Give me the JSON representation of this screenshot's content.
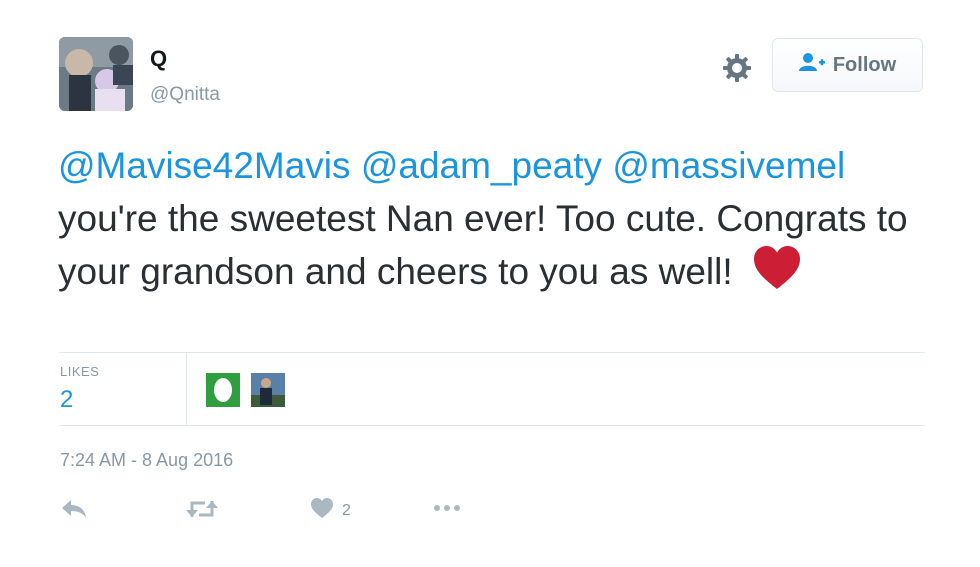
{
  "user": {
    "display_name": "Q",
    "handle": "@Qnitta"
  },
  "follow_button": {
    "label": "Follow"
  },
  "tweet": {
    "mention_1": "@Mavise42Mavis",
    "mention_2": "@adam_peaty",
    "mention_3": "@massivemel",
    "text_1": " you're the sweetest Nan ever! Too cute. Congrats to your grandson and cheers to you as well!",
    "emoji": "red-heart"
  },
  "stats": {
    "likes_label": "LIKES",
    "likes_count": "2"
  },
  "timestamp": "7:24 AM - 8 Aug 2016",
  "actions": {
    "like_count": "2"
  },
  "colors": {
    "link": "#1b95e0",
    "muted": "#8899a6",
    "heart": "#cc1f36"
  }
}
